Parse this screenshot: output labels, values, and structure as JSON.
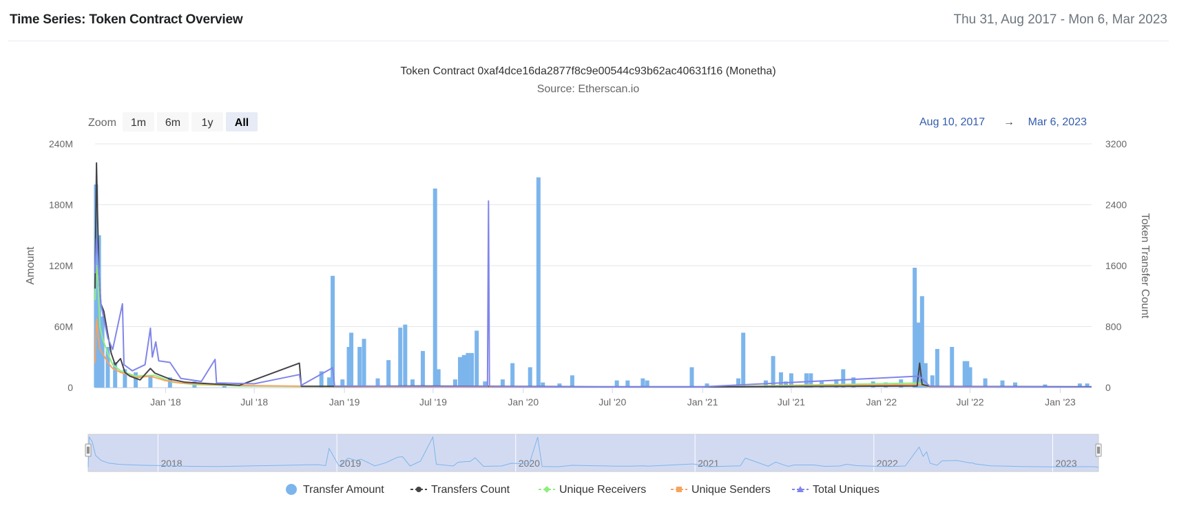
{
  "header": {
    "title": "Time Series: Token Contract Overview",
    "date_range": "Thu 31, Aug 2017 - Mon 6, Mar 2023"
  },
  "zoom": {
    "label": "Zoom",
    "buttons": [
      "1m",
      "6m",
      "1y",
      "All"
    ],
    "active": "All"
  },
  "range_selector": {
    "from": "Aug 10, 2017",
    "arrow": "→",
    "to": "Mar 6, 2023"
  },
  "colors": {
    "transfer_amount": "#7cb5ec",
    "transfers_count": "#434348",
    "unique_receivers": "#90ed7d",
    "unique_senders": "#f7a35c",
    "total_uniques": "#8085e9",
    "navigator_mask": "#cdd6ef"
  },
  "chart_data": {
    "type": "bar",
    "title": "Token Contract 0xaf4dce16da2877f8c9e00544c93b62ac40631f16 (Monetha)",
    "subtitle": "Source: Etherscan.io",
    "x_range": [
      "2017-08-10",
      "2023-03-06"
    ],
    "x_ticks": [
      {
        "date": "2018-01-01",
        "label": "Jan '18"
      },
      {
        "date": "2018-07-01",
        "label": "Jul '18"
      },
      {
        "date": "2019-01-01",
        "label": "Jan '19"
      },
      {
        "date": "2019-07-01",
        "label": "Jul '19"
      },
      {
        "date": "2020-01-01",
        "label": "Jan '20"
      },
      {
        "date": "2020-07-01",
        "label": "Jul '20"
      },
      {
        "date": "2021-01-01",
        "label": "Jan '21"
      },
      {
        "date": "2021-07-01",
        "label": "Jul '21"
      },
      {
        "date": "2022-01-01",
        "label": "Jan '22"
      },
      {
        "date": "2022-07-01",
        "label": "Jul '22"
      },
      {
        "date": "2023-01-01",
        "label": "Jan '23"
      }
    ],
    "y_left": {
      "label": "Amount",
      "min": 0,
      "max": 240000000,
      "ticks": [
        {
          "v": 0,
          "label": "0"
        },
        {
          "v": 60000000,
          "label": "60M"
        },
        {
          "v": 120000000,
          "label": "120M"
        },
        {
          "v": 180000000,
          "label": "180M"
        },
        {
          "v": 240000000,
          "label": "240M"
        }
      ]
    },
    "y_right": {
      "label": "Token Transfer Count",
      "min": 0,
      "max": 3200,
      "ticks": [
        {
          "v": 0,
          "label": "0"
        },
        {
          "v": 800,
          "label": "800"
        },
        {
          "v": 1600,
          "label": "1600"
        },
        {
          "v": 2400,
          "label": "2400"
        },
        {
          "v": 3200,
          "label": "3200"
        }
      ]
    },
    "grid": true,
    "legend_position": "bottom",
    "navigator_labels": [
      {
        "date": "2018-01-01",
        "label": "2018"
      },
      {
        "date": "2019-01-01",
        "label": "2019"
      },
      {
        "date": "2020-01-01",
        "label": "2020"
      },
      {
        "date": "2021-01-01",
        "label": "2021"
      },
      {
        "date": "2022-01-01",
        "label": "2022"
      },
      {
        "date": "2023-01-01",
        "label": "2023"
      }
    ],
    "series": [
      {
        "name": "Transfer Amount",
        "axis": "left",
        "kind": "column",
        "points": [
          [
            "2017-08-12",
            200000000
          ],
          [
            "2017-08-18",
            150000000
          ],
          [
            "2017-08-25",
            70000000
          ],
          [
            "2017-09-05",
            40000000
          ],
          [
            "2017-09-20",
            25000000
          ],
          [
            "2017-10-10",
            18000000
          ],
          [
            "2017-11-01",
            15000000
          ],
          [
            "2017-12-01",
            12000000
          ],
          [
            "2018-01-10",
            10000000
          ],
          [
            "2018-03-01",
            6000000
          ],
          [
            "2018-05-01",
            5000000
          ],
          [
            "2018-11-15",
            16000000
          ],
          [
            "2018-12-01",
            10000000
          ],
          [
            "2018-12-08",
            110000000
          ],
          [
            "2018-12-28",
            8000000
          ],
          [
            "2019-01-10",
            40000000
          ],
          [
            "2019-01-15",
            54000000
          ],
          [
            "2019-02-01",
            40000000
          ],
          [
            "2019-02-10",
            48000000
          ],
          [
            "2019-03-10",
            9000000
          ],
          [
            "2019-04-01",
            27000000
          ],
          [
            "2019-04-25",
            59000000
          ],
          [
            "2019-05-05",
            62000000
          ],
          [
            "2019-05-20",
            8000000
          ],
          [
            "2019-06-10",
            36000000
          ],
          [
            "2019-07-05",
            196000000
          ],
          [
            "2019-07-12",
            18000000
          ],
          [
            "2019-08-15",
            8000000
          ],
          [
            "2019-08-25",
            30000000
          ],
          [
            "2019-09-02",
            32000000
          ],
          [
            "2019-09-10",
            34000000
          ],
          [
            "2019-09-18",
            34000000
          ],
          [
            "2019-09-28",
            56000000
          ],
          [
            "2019-10-15",
            6000000
          ],
          [
            "2019-11-20",
            8000000
          ],
          [
            "2019-12-10",
            24000000
          ],
          [
            "2020-01-15",
            20000000
          ],
          [
            "2020-02-01",
            207000000
          ],
          [
            "2020-02-10",
            5000000
          ],
          [
            "2020-03-15",
            4000000
          ],
          [
            "2020-04-10",
            12000000
          ],
          [
            "2020-07-10",
            7000000
          ],
          [
            "2020-08-01",
            7000000
          ],
          [
            "2020-09-01",
            9000000
          ],
          [
            "2020-09-10",
            7000000
          ],
          [
            "2020-12-10",
            20000000
          ],
          [
            "2021-01-10",
            4000000
          ],
          [
            "2021-03-15",
            9000000
          ],
          [
            "2021-03-25",
            54000000
          ],
          [
            "2021-05-10",
            7000000
          ],
          [
            "2021-05-25",
            31000000
          ],
          [
            "2021-06-10",
            15000000
          ],
          [
            "2021-06-20",
            6000000
          ],
          [
            "2021-07-01",
            14000000
          ],
          [
            "2021-08-01",
            14000000
          ],
          [
            "2021-08-10",
            14000000
          ],
          [
            "2021-09-01",
            6000000
          ],
          [
            "2021-10-01",
            8000000
          ],
          [
            "2021-10-15",
            18000000
          ],
          [
            "2021-11-05",
            10000000
          ],
          [
            "2021-12-15",
            6000000
          ],
          [
            "2022-01-10",
            5000000
          ],
          [
            "2022-02-10",
            8000000
          ],
          [
            "2022-03-10",
            118000000
          ],
          [
            "2022-03-18",
            64000000
          ],
          [
            "2022-03-25",
            90000000
          ],
          [
            "2022-04-01",
            24000000
          ],
          [
            "2022-04-15",
            12000000
          ],
          [
            "2022-04-25",
            38000000
          ],
          [
            "2022-05-25",
            40000000
          ],
          [
            "2022-06-20",
            26000000
          ],
          [
            "2022-06-25",
            26000000
          ],
          [
            "2022-07-01",
            20000000
          ],
          [
            "2022-08-01",
            9000000
          ],
          [
            "2022-09-05",
            7000000
          ],
          [
            "2022-10-01",
            5000000
          ],
          [
            "2022-12-01",
            3000000
          ],
          [
            "2023-02-10",
            4000000
          ],
          [
            "2023-02-25",
            4000000
          ]
        ]
      },
      {
        "name": "Transfers Count",
        "axis": "right",
        "kind": "line",
        "points": [
          [
            "2017-08-10",
            1300
          ],
          [
            "2017-08-13",
            2950
          ],
          [
            "2017-08-15",
            2300
          ],
          [
            "2017-08-18",
            1500
          ],
          [
            "2017-08-22",
            1100
          ],
          [
            "2017-08-28",
            1000
          ],
          [
            "2017-09-05",
            700
          ],
          [
            "2017-09-12",
            450
          ],
          [
            "2017-09-20",
            300
          ],
          [
            "2017-10-01",
            380
          ],
          [
            "2017-10-10",
            200
          ],
          [
            "2017-10-20",
            150
          ],
          [
            "2017-11-10",
            100
          ],
          [
            "2017-12-01",
            250
          ],
          [
            "2017-12-10",
            190
          ],
          [
            "2018-01-10",
            110
          ],
          [
            "2018-02-10",
            70
          ],
          [
            "2018-04-01",
            50
          ],
          [
            "2018-06-01",
            30
          ],
          [
            "2018-10-01",
            320
          ],
          [
            "2018-10-05",
            15
          ],
          [
            "2019-06-01",
            20
          ],
          [
            "2019-12-01",
            15
          ],
          [
            "2020-06-01",
            10
          ],
          [
            "2021-03-01",
            10
          ],
          [
            "2022-03-15",
            20
          ],
          [
            "2022-03-20",
            320
          ],
          [
            "2022-03-25",
            40
          ],
          [
            "2022-04-10",
            15
          ],
          [
            "2023-03-06",
            10
          ]
        ]
      },
      {
        "name": "Unique Receivers",
        "axis": "right",
        "kind": "line",
        "points": [
          [
            "2017-08-10",
            1150
          ],
          [
            "2017-08-13",
            1600
          ],
          [
            "2017-08-16",
            1400
          ],
          [
            "2017-08-20",
            800
          ],
          [
            "2017-08-25",
            650
          ],
          [
            "2017-09-05",
            450
          ],
          [
            "2017-09-15",
            300
          ],
          [
            "2017-10-01",
            220
          ],
          [
            "2017-11-01",
            150
          ],
          [
            "2017-12-10",
            160
          ],
          [
            "2018-01-15",
            70
          ],
          [
            "2018-03-01",
            40
          ],
          [
            "2018-06-01",
            20
          ],
          [
            "2019-01-01",
            10
          ],
          [
            "2020-01-01",
            8
          ],
          [
            "2021-01-01",
            8
          ],
          [
            "2022-03-20",
            60
          ],
          [
            "2022-04-10",
            10
          ],
          [
            "2023-03-06",
            5
          ]
        ]
      },
      {
        "name": "Unique Senders",
        "axis": "right",
        "kind": "line",
        "points": [
          [
            "2017-08-10",
            320
          ],
          [
            "2017-08-13",
            900
          ],
          [
            "2017-08-16",
            700
          ],
          [
            "2017-08-20",
            500
          ],
          [
            "2017-08-28",
            420
          ],
          [
            "2017-09-05",
            330
          ],
          [
            "2017-09-15",
            250
          ],
          [
            "2017-10-01",
            200
          ],
          [
            "2017-10-15",
            170
          ],
          [
            "2017-11-01",
            130
          ],
          [
            "2017-12-01",
            150
          ],
          [
            "2018-01-01",
            90
          ],
          [
            "2018-02-01",
            60
          ],
          [
            "2018-04-01",
            40
          ],
          [
            "2018-07-01",
            25
          ],
          [
            "2019-01-01",
            10
          ],
          [
            "2020-01-01",
            8
          ],
          [
            "2021-01-01",
            8
          ],
          [
            "2022-03-20",
            40
          ],
          [
            "2022-04-10",
            10
          ],
          [
            "2023-03-06",
            5
          ]
        ]
      },
      {
        "name": "Total Uniques",
        "axis": "right",
        "kind": "line",
        "points": [
          [
            "2017-08-10",
            1500
          ],
          [
            "2017-08-13",
            1950
          ],
          [
            "2017-08-16",
            1700
          ],
          [
            "2017-08-22",
            1100
          ],
          [
            "2017-08-28",
            900
          ],
          [
            "2017-09-05",
            650
          ],
          [
            "2017-09-15",
            500
          ],
          [
            "2017-10-05",
            1100
          ],
          [
            "2017-10-08",
            300
          ],
          [
            "2017-10-25",
            220
          ],
          [
            "2017-11-20",
            300
          ],
          [
            "2017-12-01",
            780
          ],
          [
            "2017-12-05",
            400
          ],
          [
            "2017-12-12",
            600
          ],
          [
            "2017-12-18",
            350
          ],
          [
            "2018-01-10",
            330
          ],
          [
            "2018-02-01",
            120
          ],
          [
            "2018-03-15",
            80
          ],
          [
            "2018-04-12",
            370
          ],
          [
            "2018-04-15",
            60
          ],
          [
            "2018-07-01",
            50
          ],
          [
            "2018-10-01",
            170
          ],
          [
            "2018-10-05",
            30
          ],
          [
            "2018-12-08",
            260
          ],
          [
            "2018-12-12",
            20
          ],
          [
            "2019-06-01",
            15
          ],
          [
            "2019-10-20",
            15
          ],
          [
            "2019-10-22",
            2450
          ],
          [
            "2019-10-24",
            15
          ],
          [
            "2020-03-01",
            10
          ],
          [
            "2021-01-01",
            10
          ],
          [
            "2022-03-20",
            150
          ],
          [
            "2022-04-10",
            15
          ],
          [
            "2023-03-06",
            5
          ]
        ]
      }
    ]
  }
}
